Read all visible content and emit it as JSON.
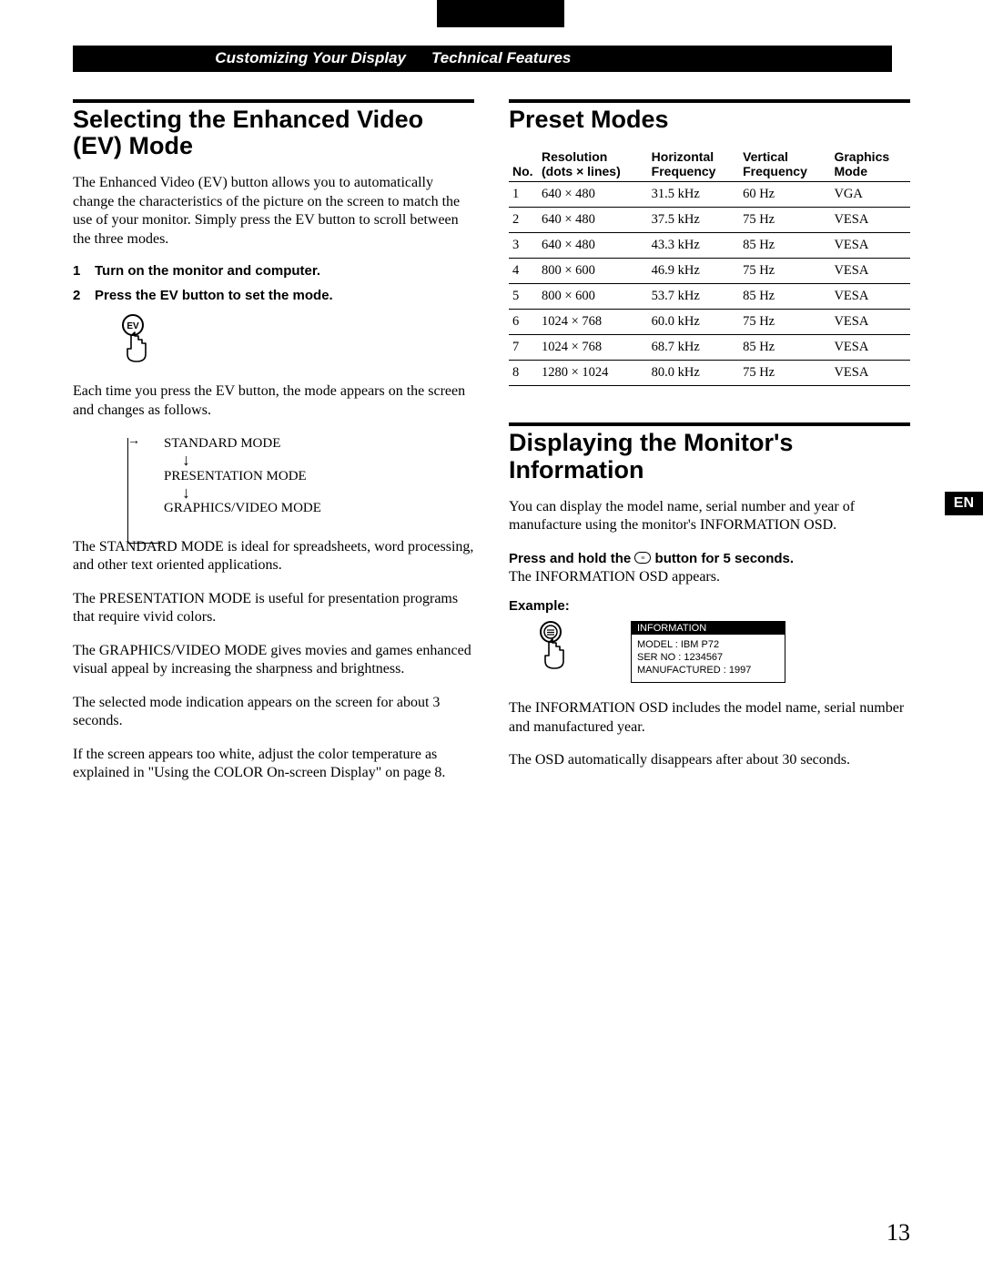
{
  "header": {
    "left": "Customizing Your Display",
    "right": "Technical Features"
  },
  "lang_tab": "EN",
  "page_number": "13",
  "left_col": {
    "title": "Selecting the Enhanced Video (EV) Mode",
    "intro": "The Enhanced Video (EV) button allows you to automatically change the characteristics of the picture on the screen to match the use of your monitor. Simply press the EV button to scroll between the three modes.",
    "steps": [
      {
        "n": "1",
        "text": "Turn on the monitor and computer."
      },
      {
        "n": "2",
        "text": "Press the EV button to set the mode."
      }
    ],
    "ev_icon_label": "EV",
    "after_steps": "Each time you press the EV button, the mode appears on the screen and changes as follows.",
    "modes": {
      "a": "STANDARD MODE",
      "b": "PRESENTATION MODE",
      "c": "GRAPHICS/VIDEO MODE"
    },
    "p1": "The STANDARD MODE is ideal for spreadsheets, word processing, and other text oriented applications.",
    "p2": "The PRESENTATION MODE is useful for presentation programs that require vivid colors.",
    "p3": "The GRAPHICS/VIDEO MODE gives movies and games enhanced visual appeal by increasing the sharpness and brightness.",
    "p4": "The selected mode indication appears on the screen for about 3 seconds.",
    "p5": "If the screen appears too white, adjust the color temperature as explained in \"Using the COLOR On-screen Display\" on page 8."
  },
  "right_col": {
    "preset_title": "Preset Modes",
    "table_headers": {
      "no": "No.",
      "res_l1": "Resolution",
      "res_l2": "(dots × lines)",
      "hf_l1": "Horizontal",
      "hf_l2": "Frequency",
      "vf_l1": "Vertical",
      "vf_l2": "Frequency",
      "gm_l1": "Graphics",
      "gm_l2": "Mode"
    },
    "rows": [
      {
        "no": "1",
        "res": "640 × 480",
        "hf": "31.5 kHz",
        "vf": "60 Hz",
        "gm": "VGA"
      },
      {
        "no": "2",
        "res": "640 × 480",
        "hf": "37.5 kHz",
        "vf": "75 Hz",
        "gm": "VESA"
      },
      {
        "no": "3",
        "res": "640 × 480",
        "hf": "43.3 kHz",
        "vf": "85 Hz",
        "gm": "VESA"
      },
      {
        "no": "4",
        "res": "800 × 600",
        "hf": "46.9 kHz",
        "vf": "75 Hz",
        "gm": "VESA"
      },
      {
        "no": "5",
        "res": "800 × 600",
        "hf": "53.7 kHz",
        "vf": "85 Hz",
        "gm": "VESA"
      },
      {
        "no": "6",
        "res": "1024 × 768",
        "hf": "60.0 kHz",
        "vf": "75 Hz",
        "gm": "VESA"
      },
      {
        "no": "7",
        "res": "1024 × 768",
        "hf": "68.7 kHz",
        "vf": "85 Hz",
        "gm": "VESA"
      },
      {
        "no": "8",
        "res": "1280 × 1024",
        "hf": "80.0 kHz",
        "vf": "75 Hz",
        "gm": "VESA"
      }
    ],
    "info_title": "Displaying the Monitor's Information",
    "info_intro": "You can display the model name, serial number and year of manufacture using the monitor's INFORMATION OSD.",
    "press_hold_pre": "Press and hold the ",
    "press_hold_post": " button for 5 seconds.",
    "info_osd_appears": "The INFORMATION OSD appears.",
    "example_label": "Example:",
    "osd": {
      "title": "INFORMATION",
      "l1": "MODEL : IBM P72",
      "l2": "SER NO : 1234567",
      "l3": "MANUFACTURED : 1997"
    },
    "info_p1": "The INFORMATION OSD includes the model name, serial number and manufactured year.",
    "info_p2": "The OSD automatically disappears after about 30 seconds."
  }
}
